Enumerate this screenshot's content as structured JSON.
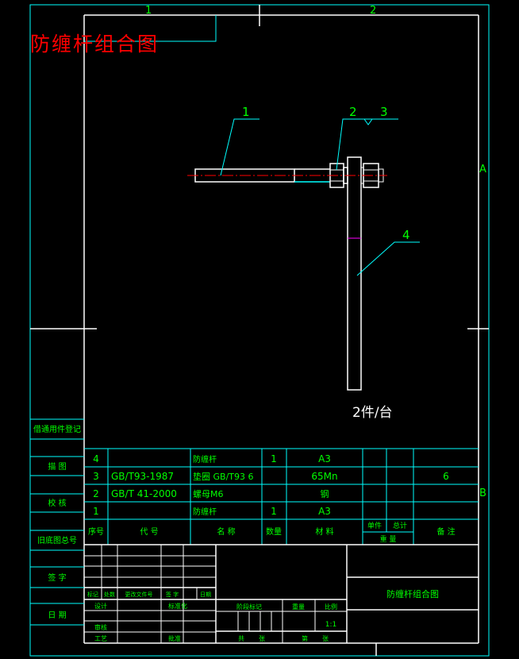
{
  "drawing": {
    "title": "防缠杆组合图",
    "zone_numbers": [
      "1",
      "2"
    ],
    "zone_letters": [
      "A",
      "B"
    ],
    "balloons": [
      "1",
      "2",
      "3",
      "4"
    ],
    "quantity_note": "2件/台"
  },
  "side_labels": [
    "借通用件登记",
    "描 图",
    "校 核",
    "旧底图总号",
    "签 字",
    "日 期"
  ],
  "bom": {
    "headers": {
      "seq": "序号",
      "code": "代 号",
      "name": "名 称",
      "qty": "数量",
      "material": "材 料",
      "unit": "单件",
      "total": "总计",
      "weight": "重 量",
      "remark": "备 注"
    },
    "rows": [
      {
        "seq": "4",
        "code": "",
        "name": "防缠杆",
        "qty": "",
        "material": "A3",
        "remark": ""
      },
      {
        "seq": "3",
        "code": "GB/T93-1987",
        "name": "垫圈 GB/T93 6",
        "qty": "",
        "material": "65Mn",
        "remark": "6"
      },
      {
        "seq": "2",
        "code": "GB/T 41-2000",
        "name": "螺母M6",
        "qty": "",
        "material": "钢",
        "remark": ""
      },
      {
        "seq": "1",
        "code": "",
        "name": "防缠杆",
        "qty": "1",
        "material": "A3",
        "remark": ""
      }
    ],
    "row4_qty": "1"
  },
  "title_block": {
    "rev_labels": [
      "标记",
      "处数",
      "更改文件号",
      "签 字",
      "日期"
    ],
    "designer": "设计",
    "checker": "审核",
    "process": "工艺",
    "std": "标准化",
    "approve": "批准",
    "stage_mark": "阶段标记",
    "weight": "重量",
    "scale": "比例",
    "scale_value": "1:1",
    "sheet_total": "共",
    "sheet_no": "张",
    "sheet_of": "第",
    "sheet_unit": "张",
    "drawing_name": "防缠杆组合图"
  },
  "colors": {
    "frame": "#ffffff",
    "green": "#00ff00",
    "cyan": "#00ffff",
    "red": "#ff0000",
    "yellow": "#ffff00",
    "magenta": "#ff00ff"
  }
}
